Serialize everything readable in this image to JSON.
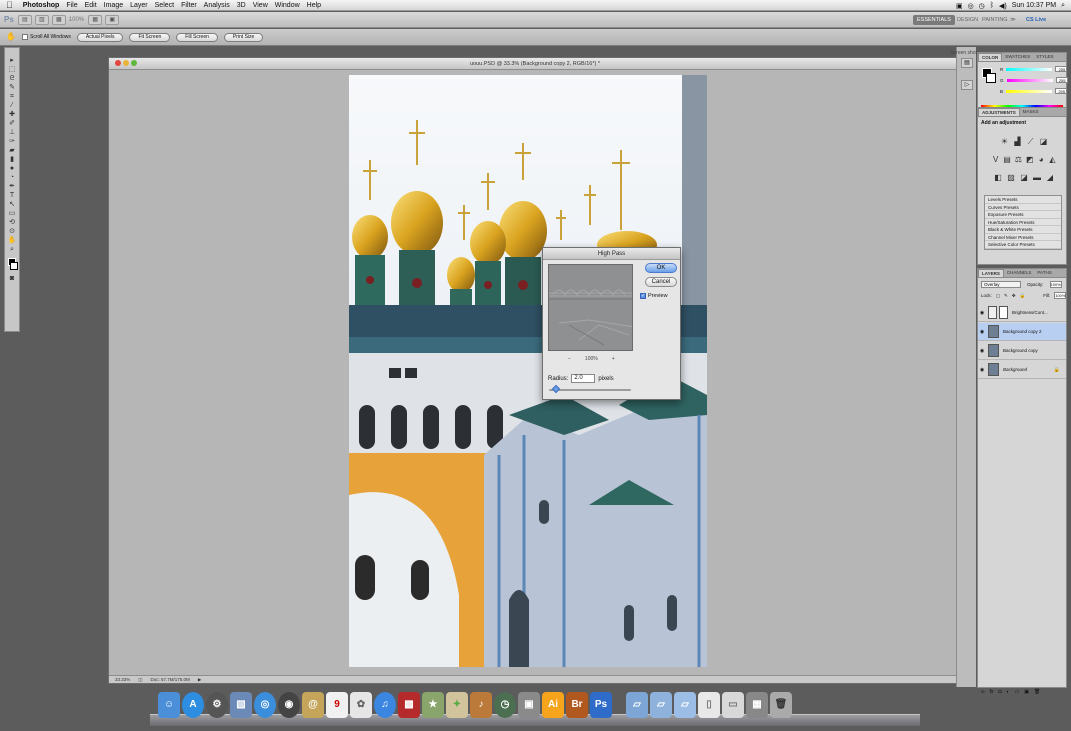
{
  "menubar": {
    "items": [
      "Photoshop",
      "File",
      "Edit",
      "Image",
      "Layer",
      "Select",
      "Filter",
      "Analysis",
      "3D",
      "View",
      "Window",
      "Help"
    ],
    "clock": "Sun 10:37 PM"
  },
  "appbar": {
    "app_abbr": "Ps",
    "zoom": "100%",
    "workspaces": [
      "ESSENTIALS",
      "DESIGN",
      "PAINTING",
      "≫"
    ],
    "cs_live": "CS Live"
  },
  "options": {
    "scroll_all_windows": "Scroll All Windows",
    "buttons": [
      "Actual Pixels",
      "Fit Screen",
      "Fill Screen",
      "Print Size"
    ]
  },
  "document": {
    "title": "uouu.PSD @ 33.3% (Background copy 2, RGB/16*) *",
    "zoom_status": "33.33%",
    "doc_size": "Doc: 57.7M/175.0M",
    "screenshot_label": "Screen shot"
  },
  "dialog": {
    "title": "High Pass",
    "ok": "OK",
    "cancel": "Cancel",
    "preview_label": "Preview",
    "preview_checked": true,
    "preview_zoom": "100%",
    "zoom_minus": "−",
    "zoom_plus": "+",
    "radius_label": "Radius:",
    "radius_value": "2.0",
    "radius_unit": "pixels",
    "radius_fraction": 0.05
  },
  "color_panel": {
    "tabs": [
      "COLOR",
      "SWATCHES",
      "STYLES"
    ],
    "channels": [
      {
        "label": "R",
        "value": "255",
        "color": "#ff0000"
      },
      {
        "label": "G",
        "value": "255",
        "color": "#00ff00"
      },
      {
        "label": "B",
        "value": "255",
        "color": "#0000ff"
      }
    ]
  },
  "adjustments_panel": {
    "tabs": [
      "ADJUSTMENTS",
      "MASKS"
    ],
    "header": "Add an adjustment",
    "presets": [
      "Levels Presets",
      "Curves Presets",
      "Exposure Presets",
      "Hue/Saturation Presets",
      "Black & White Presets",
      "Channel Mixer Presets",
      "Selective Color Presets"
    ]
  },
  "layers_panel": {
    "tabs": [
      "LAYERS",
      "CHANNELS",
      "PATHS"
    ],
    "blend_mode": "Overlay",
    "opacity_label": "Opacity:",
    "opacity": "100%",
    "lock_label": "Lock:",
    "fill_label": "Fill:",
    "fill": "100%",
    "layers": [
      {
        "name": "Brightness/Cont...",
        "visible": true,
        "selected": false
      },
      {
        "name": "Background copy 2",
        "visible": true,
        "selected": true
      },
      {
        "name": "Background copy",
        "visible": true,
        "selected": false
      },
      {
        "name": "Background",
        "visible": true,
        "selected": false,
        "locked": true
      }
    ]
  },
  "dock": {
    "labels": [
      "Ai",
      "Br",
      "Ps"
    ],
    "colors": {
      "ai": "#f7a41d",
      "br": "#b0581e",
      "ps": "#2f6cc9"
    }
  }
}
